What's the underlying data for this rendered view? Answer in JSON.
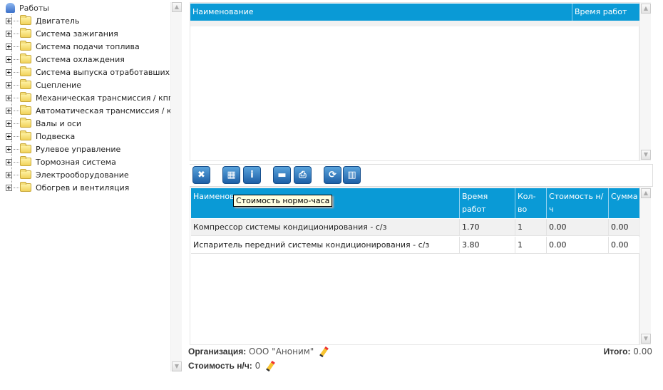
{
  "tree": {
    "root": "Работы",
    "items": [
      "Двигатель",
      "Система зажигания",
      "Система подачи топлива",
      "Система охлаждения",
      "Система выпуска отработавших газов",
      "Сцепление",
      "Механическая трансмиссия / кпп",
      "Автоматическая трансмиссия / кпп",
      "Валы и оси",
      "Подвеска",
      "Рулевое управление",
      "Тормозная система",
      "Электрооборудование",
      "Обогрев и вентиляция"
    ]
  },
  "top_table": {
    "columns": [
      "Наименование",
      "Время работ"
    ]
  },
  "toolbar": {
    "buttons": [
      {
        "name": "delete",
        "glyph": "✖"
      },
      {
        "name": "calculator",
        "glyph": "▦"
      },
      {
        "name": "info",
        "glyph": "i"
      },
      {
        "name": "save",
        "glyph": "▬"
      },
      {
        "name": "print",
        "glyph": "⎙"
      },
      {
        "name": "refresh",
        "glyph": "⟳"
      },
      {
        "name": "trash",
        "glyph": "▥"
      }
    ],
    "tooltip": "Стоимость нормо-часа"
  },
  "bottom_table": {
    "columns": [
      "Наименование",
      "Время работ",
      "Кол-во",
      "Стоимость н/ч",
      "Сумма"
    ],
    "rows": [
      [
        "Компрессор системы кондиционирования - с/з",
        "1.70",
        "1",
        "0.00",
        "0.00"
      ],
      [
        "Испаритель передний системы кондиционирования - с/з",
        "3.80",
        "1",
        "0.00",
        "0.00"
      ]
    ]
  },
  "footer": {
    "org_label": "Организация:",
    "org_value": "ООО \"Аноним\"",
    "rate_label": "Стоимость н/ч:",
    "rate_value": "0",
    "total_label": "Итого:",
    "total_value": "0.00"
  },
  "colors": {
    "header": "#0a9ad6",
    "row_alt": "#f1f1f1"
  }
}
